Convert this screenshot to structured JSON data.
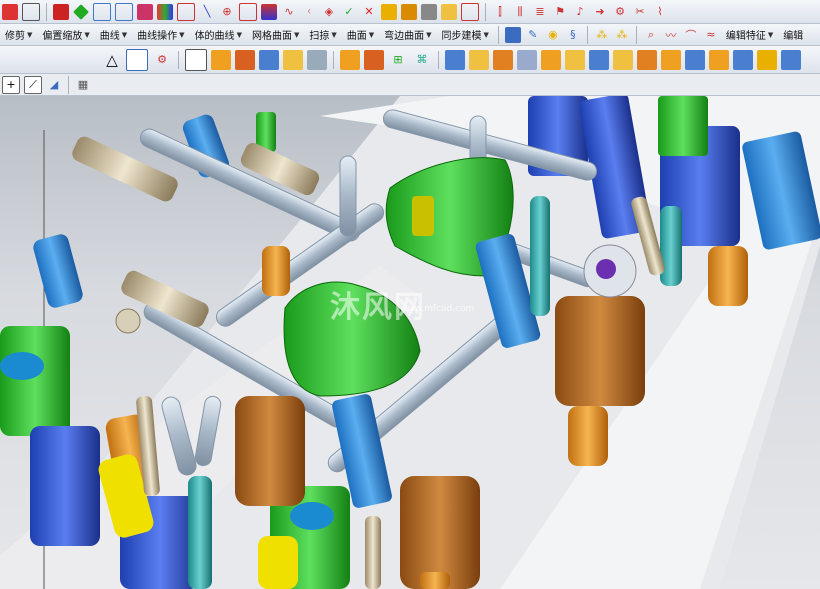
{
  "menubar": {
    "items": [
      {
        "label": "修剪",
        "icon": "none"
      },
      {
        "label": "偏置缩放"
      },
      {
        "label": "曲线"
      },
      {
        "label": "曲线操作"
      },
      {
        "label": "体的曲线"
      },
      {
        "label": "网格曲面"
      },
      {
        "label": "扫掠"
      },
      {
        "label": "曲面"
      },
      {
        "label": "弯边曲面"
      },
      {
        "label": "同步建模"
      },
      {
        "label": "编辑特征"
      },
      {
        "label": "编辑"
      }
    ]
  },
  "watermark": {
    "text": "沐风网",
    "url": "www.mfcad.com"
  },
  "colors": {
    "accent": "#3b6cc0",
    "toolbar_bg": "#e6eaf0"
  }
}
